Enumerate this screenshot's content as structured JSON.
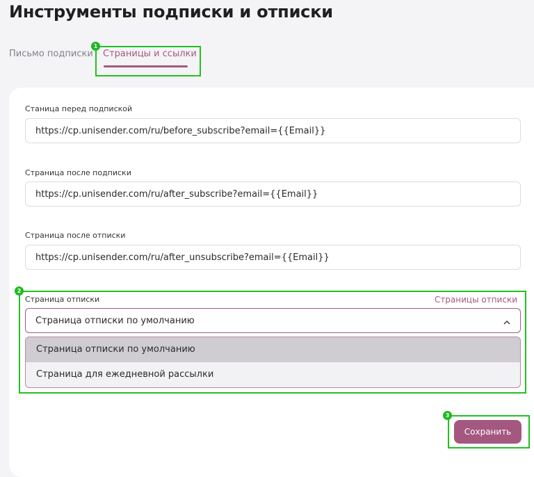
{
  "page": {
    "title": "Инструменты подписки и отписки"
  },
  "tabs": [
    {
      "label": "Письмо подписки"
    },
    {
      "label": "Страницы и ссылки"
    }
  ],
  "fields": {
    "before_subscribe": {
      "label": "Станица перед подпиской",
      "value": "https://cp.unisender.com/ru/before_subscribe?email={{Email}}"
    },
    "after_subscribe": {
      "label": "Страница после подписки",
      "value": "https://cp.unisender.com/ru/after_subscribe?email={{Email}}"
    },
    "after_unsubscribe": {
      "label": "Страница после отписки",
      "value": "https://cp.unisender.com/ru/after_unsubscribe?email={{Email}}"
    },
    "unsubscribe_page": {
      "label": "Страница отписки",
      "link": "Страницы отписки",
      "selected": "Страница отписки по умолчанию",
      "options": [
        "Страница отписки по умолчанию",
        "Страница для ежедневной рассылки"
      ]
    }
  },
  "actions": {
    "save_label": "Сохранить"
  },
  "annotations": [
    "1",
    "2",
    "3"
  ],
  "colors": {
    "accent": "#a4587f",
    "highlight": "#1fc21f",
    "background": "#f4f4f7"
  },
  "icons": {
    "select_toggle": "chevron-up-icon"
  }
}
